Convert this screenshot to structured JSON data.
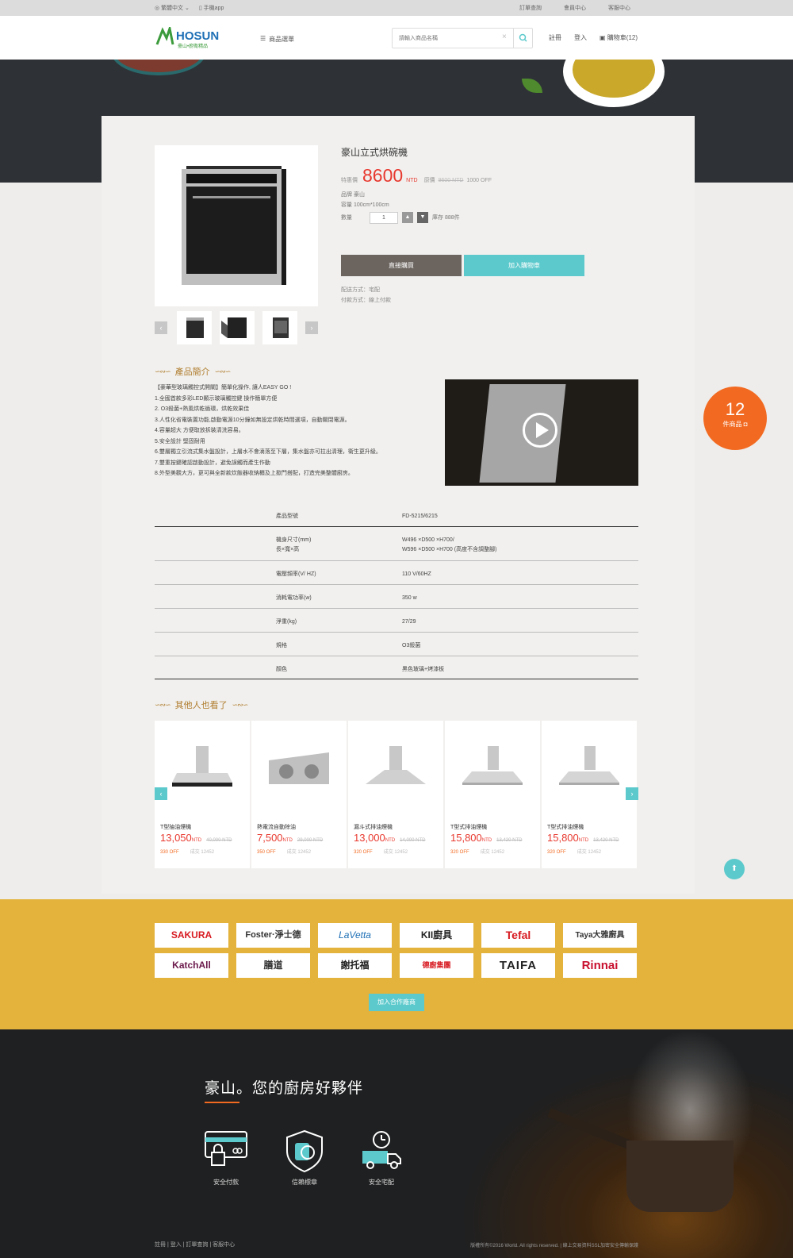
{
  "topbar": {
    "language": "繁體中文 ⌄",
    "app": "手機app",
    "links": [
      "訂單查詢",
      "會員中心",
      "客服中心"
    ]
  },
  "header": {
    "logo_text": "HOSUN",
    "logo_sub": "豪山•廚衛精品",
    "menu_label": "商品選單",
    "search_placeholder": "請輸入商品名稱",
    "register": "註冊",
    "login": "登入",
    "cart": "購物車(12)"
  },
  "product": {
    "title": "豪山立式烘碗機",
    "special_label": "特惠價",
    "price": "8600",
    "price_unit": "NTD",
    "orig_label": "原價",
    "orig_price": "9600 NTD",
    "discount": "1000 OFF",
    "brand": "品牌  豪山",
    "capacity": "容量  100cm*100cm",
    "qty_label": "數量",
    "qty_value": "1",
    "stock": "庫存 888件",
    "buy_now": "直接購買",
    "add_cart": "加入購物車",
    "shipping": "配送方式：宅配",
    "payment": "付款方式：線上付款"
  },
  "intro": {
    "heading": "產品簡介",
    "lines": [
      "【豪華型玻璃觸控式開關】簡單化操作, 讓人EASY GO !",
      "1.全國首款多彩LED顯示玻璃觸控鍵 操作簡單方便",
      "2. O3殺菌+熱風烘乾循環，烘乾效果佳",
      "3.人性化省電裝置功能,啟動電源10分鐘如無設定烘乾時間選項，自動關閉電源。",
      "4.容量超大 方便取放拆裝清洗容易。",
      "5.安全設計 堅固耐用",
      "6.雙層獨立引流式集水盤設計，上層水不會滴落至下層，集水盤亦可拉出清理，衛生更升級。",
      "7.雙重按鍵確認啟動設計，避免誤觸而產生作動",
      "8.外型美觀大方，更可與全新款炊飯器收納櫃及上掀門搭配，打造完美整體廚房。"
    ]
  },
  "cart_badge": {
    "count": "12",
    "label": "件商品"
  },
  "specs": [
    {
      "k": "產品型號",
      "v": "FD-5215/6215"
    },
    {
      "k": "機身尺寸(mm)\n長×寬×高",
      "v": "W496 ×D500 ×H700/\nW596 ×D500 ×H700 (高度不含調整腳)"
    },
    {
      "k": "電壓頻率(V/ HZ)",
      "v": "110 V/60HZ"
    },
    {
      "k": "消耗電功率(w)",
      "v": "350 w"
    },
    {
      "k": "淨重(kg)",
      "v": "27/29"
    },
    {
      "k": "規格",
      "v": "O3殺菌"
    },
    {
      "k": "顏色",
      "v": "黑色玻璃+烤漆板"
    }
  ],
  "others": {
    "heading": "其他人也看了",
    "items": [
      {
        "name": "T型抽油煙機",
        "price": "13,050",
        "unit": "NTD",
        "orig": "40,000 NTD",
        "off": "330 OFF",
        "sold": "成交 12452"
      },
      {
        "name": "熱電流自動除油",
        "price": "7,500",
        "unit": "NTD",
        "orig": "29,000 NTD",
        "off": "350 OFF",
        "sold": "成交 12452"
      },
      {
        "name": "漏斗式排油煙機",
        "price": "13,000",
        "unit": "NTD",
        "orig": "14,000 NTD",
        "off": "320 OFF",
        "sold": "成交 12452"
      },
      {
        "name": "T型式排油煙機",
        "price": "15,800",
        "unit": "NTD",
        "orig": "13,420 NTD",
        "off": "320 OFF",
        "sold": "成交 12452"
      },
      {
        "name": "T型式排油煙機",
        "price": "15,800",
        "unit": "NTD",
        "orig": "13,420 NTD",
        "off": "320 OFF",
        "sold": "成交 12452"
      }
    ]
  },
  "partners": {
    "brands": [
      "SAKURA",
      "Foster·淨士德",
      "LaVetta",
      "KII廚具",
      "Tefal",
      "Taya大雅廚具",
      "KatchAll",
      "膳道",
      "謝托福",
      "德廚集團",
      "TAIFA",
      "Rinnai"
    ],
    "join": "加入合作廠商"
  },
  "footer": {
    "slogan": "豪山。您的廚房好夥伴",
    "features": [
      "安全付款",
      "信賴標章",
      "安全宅配"
    ],
    "links": "註冊  |  登入  |  訂單查詢  |  客服中心",
    "copyright": "版權所有©2016 World. All rights reserved. | 線上交易資料SSL加密安全傳輸保護"
  },
  "colors": {
    "accent": "#5cc9cc",
    "price": "#e8382e",
    "orange": "#f26a21",
    "gold": "#e3b33c"
  }
}
